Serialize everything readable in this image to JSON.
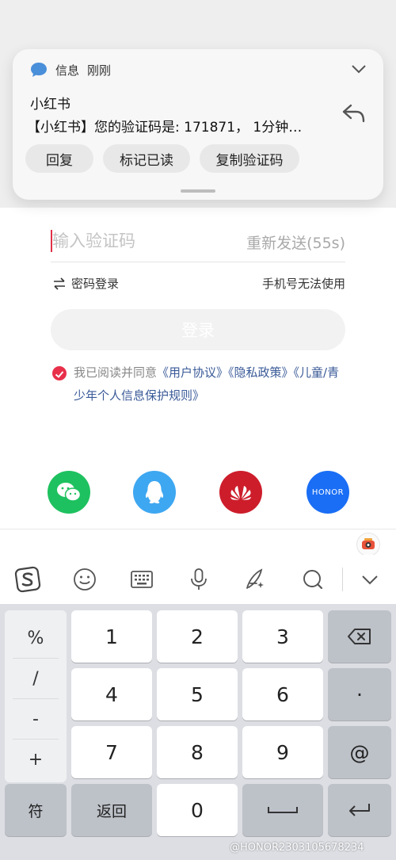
{
  "notification": {
    "app_name": "信息",
    "time": "刚刚",
    "title": "小红书",
    "body": "【小红书】您的验证码是: 171871， 1分钟…",
    "actions": [
      "回复",
      "标记已读",
      "复制验证码"
    ]
  },
  "form": {
    "code_placeholder": "输入验证码",
    "resend_label": "重新发送(55s)",
    "password_login": "密码登录",
    "phone_unavailable": "手机号无法使用",
    "login_button": "登录",
    "agreement": {
      "prefix": "我已阅读并同意",
      "user_agreement": "《用户协议》",
      "privacy_policy": "《隐私政策》",
      "minor_policy": "《儿童/青少年个人信息保护规则》"
    }
  },
  "social_logins": [
    "wechat",
    "qq",
    "huawei",
    "honor"
  ],
  "social_honor_label": "HONOR",
  "keyboard": {
    "symbols": [
      "%",
      "/",
      "-",
      "+"
    ],
    "digits": [
      "1",
      "2",
      "3",
      "4",
      "5",
      "6",
      "7",
      "8",
      "9",
      "0"
    ],
    "dot": "·",
    "at": "@",
    "symbol_key": "符",
    "back_key": "返回"
  },
  "watermark": "@HONOR2303105678234",
  "colors": {
    "accent_red": "#e8304b",
    "wechat": "#1ec15f",
    "qq": "#3ea7f1",
    "huawei": "#cd1d2b",
    "honor": "#1a6ef5",
    "link": "#3a5a98"
  },
  "icons": [
    "message-icon",
    "chevron-down-icon",
    "reply-icon",
    "swap-icon",
    "sogou-icon",
    "emoji-icon",
    "keyboard-icon",
    "microphone-icon",
    "handwriting-icon",
    "search-icon",
    "backspace-icon",
    "space-icon",
    "enter-icon"
  ]
}
